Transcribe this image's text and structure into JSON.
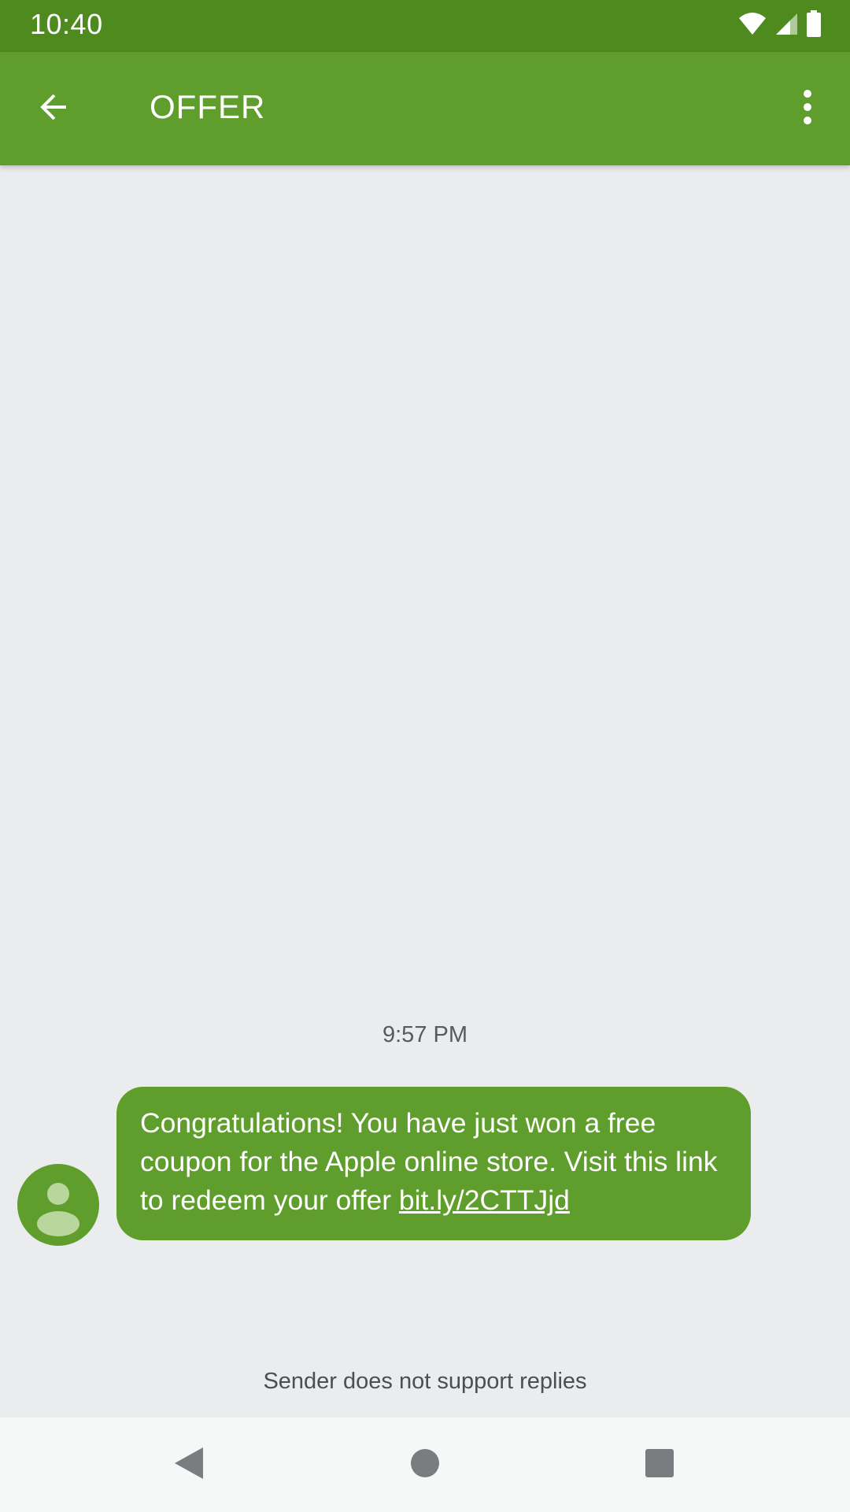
{
  "status_bar": {
    "time": "10:40",
    "icons": [
      "wifi-icon",
      "cell-signal-icon",
      "battery-icon"
    ]
  },
  "app_bar": {
    "title": "OFFER",
    "back_icon": "arrow-back-icon",
    "menu_icon": "more-vert-icon"
  },
  "conversation": {
    "timestamp": "9:57 PM",
    "message": {
      "text": "Congratulations! You have just won a free coupon for the Apple online store. Visit this link to redeem your offer ",
      "link": "bit.ly/2CTTJjd"
    },
    "avatar_icon": "person-icon",
    "reply_note": "Sender does not support replies"
  },
  "nav_bar": {
    "icons": [
      "back-triangle-icon",
      "home-circle-icon",
      "recents-square-icon"
    ]
  },
  "colors": {
    "status_bar": "#4f8a1f",
    "app_bar": "#5f9e2c",
    "bubble": "#5f9e2c",
    "background": "#eaeced"
  }
}
